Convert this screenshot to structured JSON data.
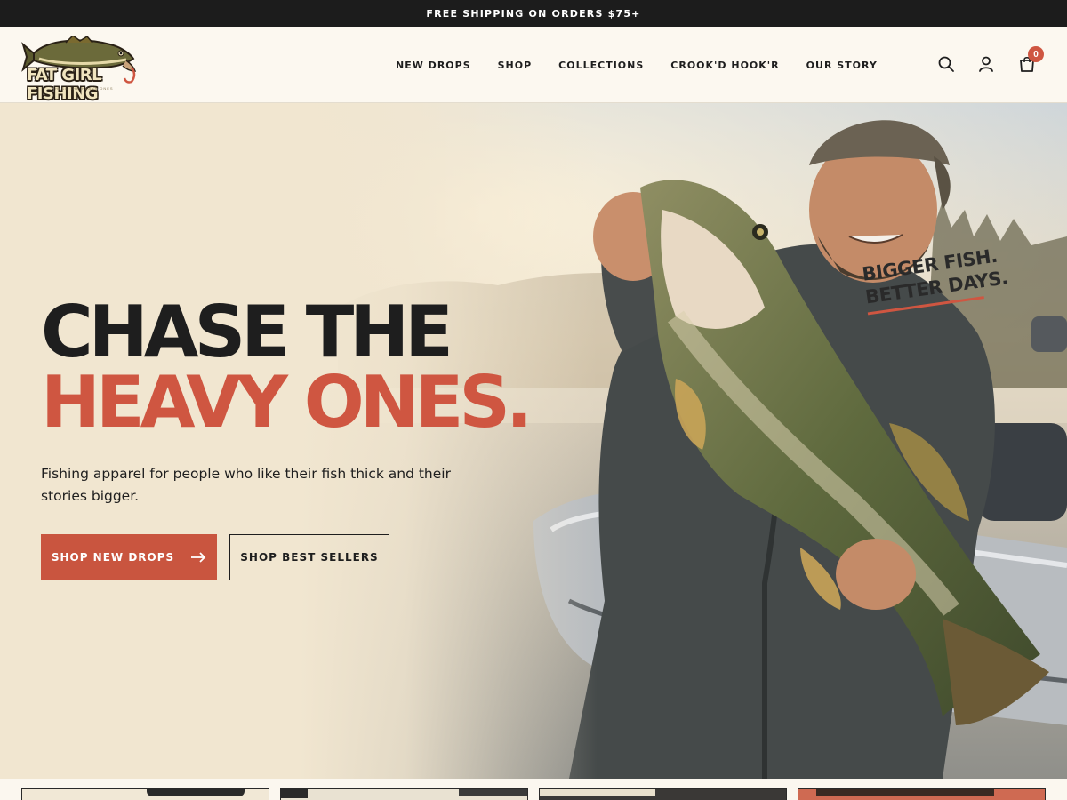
{
  "announcement": {
    "text": "FREE SHIPPING ON ORDERS $75+"
  },
  "header": {
    "logo": {
      "text": "FAT GIRL FISHING",
      "tagline": "CHASE THE HEAVY ONES"
    },
    "nav": [
      {
        "label": "NEW DROPS"
      },
      {
        "label": "SHOP"
      },
      {
        "label": "COLLECTIONS"
      },
      {
        "label": "CROOK'D HOOK'R"
      },
      {
        "label": "OUR STORY"
      }
    ],
    "icons": {
      "search": "search-icon",
      "account": "user-icon",
      "cart": "shopping-bag-icon"
    },
    "cart_count": "0"
  },
  "hero": {
    "headline_line1": "CHASE THE",
    "headline_line2": "HEAVY ONES.",
    "subtitle": "Fishing apparel for people who like their fish thick and their stories bigger.",
    "primary_button": "SHOP NEW DROPS",
    "primary_button_icon": "arrow-right-icon",
    "secondary_button": "SHOP BEST SELLERS",
    "shirt_line1": "BIGGER FISH.",
    "shirt_line2": "BETTER DAYS."
  },
  "colors": {
    "accent": "#cf5641",
    "dark": "#1c1c1c",
    "background": "#fbf7ef"
  },
  "product_strip": {
    "tile_count": 4
  }
}
